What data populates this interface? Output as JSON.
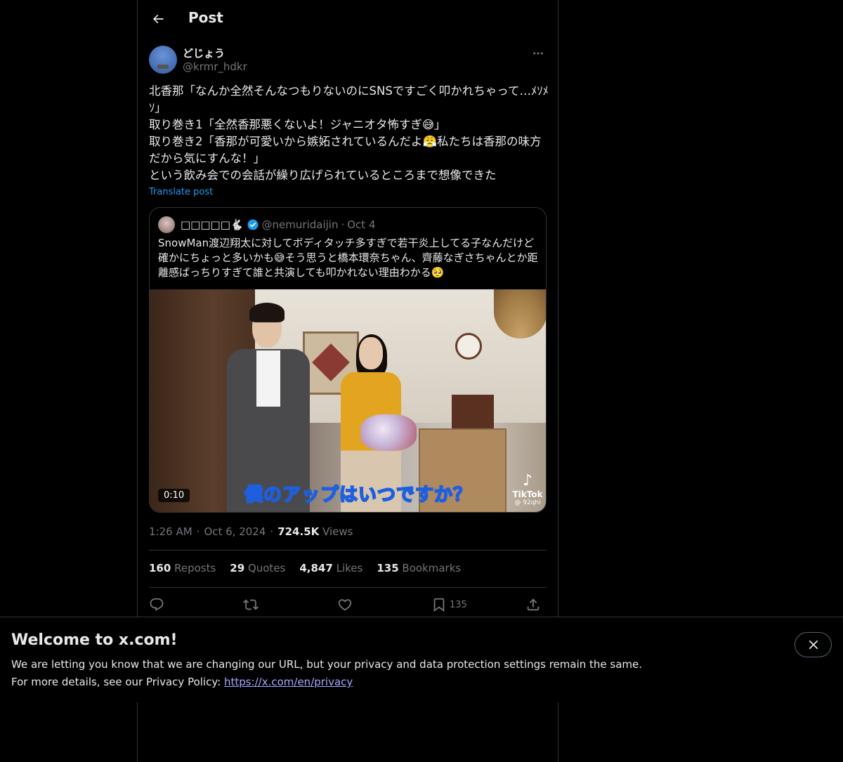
{
  "header": {
    "title": "Post"
  },
  "post": {
    "author": {
      "display_name": "どじょう",
      "handle": "@krmr_hdkr"
    },
    "text": "北香那「なんか全然そんなつもりないのにSNSですごく叩かれちゃって…ﾒｿﾒｿ」\n取り巻き1「全然香那悪くないよ！ジャニオタ怖すぎ😅」\n取り巻き2「香那が可愛いから嫉妬されているんだよ😤私たちは香那の味方だから気にすんな！」\nという飲み会での会話が繰り広げられているところまで想像できた",
    "translate_label": "Translate post",
    "time": "1:26 AM",
    "date": "Oct 6, 2024",
    "views_count": "724.5K",
    "views_label": "Views"
  },
  "quote": {
    "display_name": "□□□□□🐇",
    "handle": "@nemuridaijin",
    "date": "Oct 4",
    "text": "SnowMan渡辺翔太に対してボディタッチ多すぎで若干炎上してる子なんだけど確かにちょっと多いかも😅そう思うと橋本環奈ちゃん、齊藤なぎさちゃんとか距離感ばっちりすぎて誰と共演しても叩かれない理由わかる🥺",
    "video": {
      "duration": "0:10",
      "caption": "僕のアップはいつですか？",
      "watermark": "TikTok",
      "watermark_user": "@ 92qhi"
    }
  },
  "stats": [
    {
      "count": "160",
      "label": "Reposts"
    },
    {
      "count": "29",
      "label": "Quotes"
    },
    {
      "count": "4,847",
      "label": "Likes"
    },
    {
      "count": "135",
      "label": "Bookmarks"
    }
  ],
  "actions": {
    "bookmark_count": "135"
  },
  "banner": {
    "title": "Welcome to x.com!",
    "line1": "We are letting you know that we are changing our URL, but your privacy and data protection settings remain the same.",
    "line2_prefix": "For more details, see our Privacy Policy: ",
    "link": "https://x.com/en/privacy"
  },
  "colors": {
    "accent": "#1d9bf0",
    "muted": "#71767b",
    "border": "#2f3336",
    "link": "#a7a5ff"
  },
  "icons": {
    "back": "arrow-left-icon",
    "more": "more-horizontal-icon",
    "verified": "verified-badge-icon",
    "reply": "reply-icon",
    "repost": "repost-icon",
    "like": "heart-icon",
    "bookmark": "bookmark-icon",
    "share": "share-icon",
    "close": "close-icon",
    "tiktok": "tiktok-logo-icon"
  }
}
